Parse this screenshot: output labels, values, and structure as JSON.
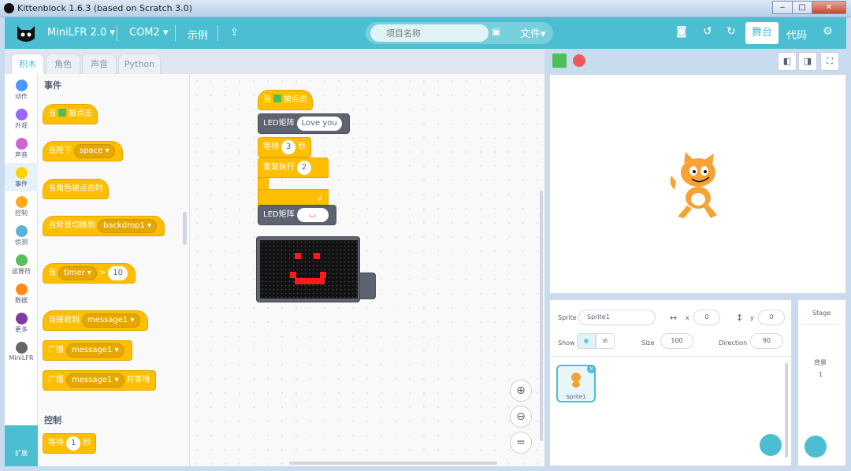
{
  "window": {
    "title": "Kittenblock 1.6.3 (based on Scratch 3.0)",
    "min": "‒",
    "max": "□",
    "close": "✕"
  },
  "menu": {
    "device": "MiniLFR 2.0",
    "port": "COM2",
    "examples": "示例",
    "project_placeholder": "项目名称",
    "file": "文件",
    "stage": "舞台",
    "code": "代码"
  },
  "tabs": [
    "积木",
    "角色",
    "声音",
    "Python"
  ],
  "categories": [
    {
      "label": "动作",
      "color": "#4c97ff"
    },
    {
      "label": "外观",
      "color": "#9966ff"
    },
    {
      "label": "声音",
      "color": "#cf63cf"
    },
    {
      "label": "事件",
      "color": "#ffd500"
    },
    {
      "label": "控制",
      "color": "#ffab19"
    },
    {
      "label": "侦测",
      "color": "#5cb1d6"
    },
    {
      "label": "运算符",
      "color": "#59c059"
    },
    {
      "label": "数据",
      "color": "#ff8c1a"
    },
    {
      "label": "更多",
      "color": "#7e3aa1"
    },
    {
      "label": "MiniLFR",
      "color": "#666666"
    }
  ],
  "palette": {
    "events_header": "事件",
    "b1_a": "当",
    "b1_b": "被点击",
    "b2_a": "当按下",
    "b2_dd": "space",
    "b3": "当角色被点击时",
    "b4_a": "当背景切换到",
    "b4_dd": "backdrop1",
    "b5_a": "当",
    "b5_dd": "timer",
    "b5_op": ">",
    "b5_num": "10",
    "b6_a": "当接收到",
    "b6_dd": "message1",
    "b7_a": "广播",
    "b7_dd": "message1",
    "b8_a": "广播",
    "b8_dd": "message1",
    "b8_b": "并等待",
    "control_header": "控制",
    "b9_a": "等待",
    "b9_num": "1",
    "b9_b": "秒"
  },
  "script": {
    "hat_a": "当",
    "hat_b": "被点击",
    "led1_label": "LED矩阵",
    "led1_text": "Love you",
    "wait_a": "等待",
    "wait_num": "3",
    "wait_b": "秒",
    "repeat_a": "重复执行",
    "repeat_num": "2",
    "led2_label": "LED矩阵",
    "loop_arrow": "↲"
  },
  "extension_label": "扩展",
  "sprite": {
    "label": "Sprite",
    "name": "Sprite1",
    "x_label": "x",
    "x": "0",
    "y_label": "y",
    "y": "0",
    "show_label": "Show",
    "size_label": "Size",
    "size": "100",
    "direction_label": "Direction",
    "direction": "90",
    "thumb_name": "Sprite1"
  },
  "stage_panel": {
    "title": "Stage",
    "backdrop_label": "背景",
    "backdrop_count": "1"
  },
  "colors": {
    "accent": "#4bbfd1",
    "event": "#ffbf00",
    "led": "#ff1a1a"
  }
}
